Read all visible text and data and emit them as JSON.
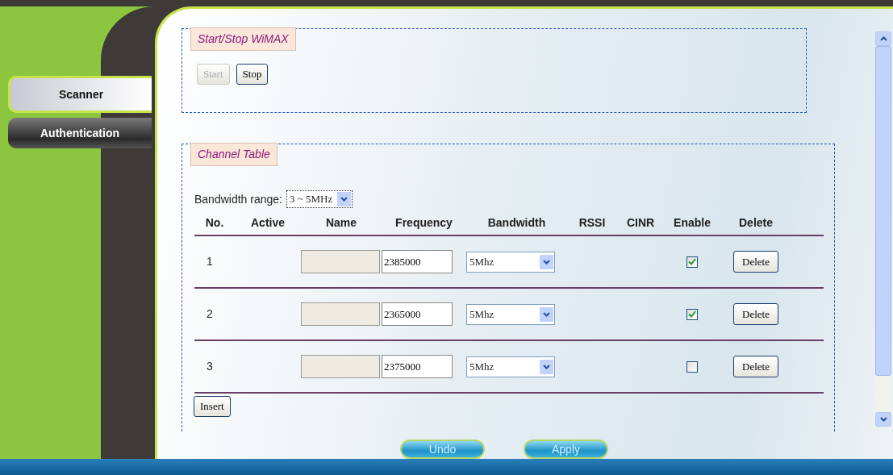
{
  "sidebar": {
    "tabs": [
      {
        "label": "Scanner",
        "selected": true
      },
      {
        "label": "Authentication",
        "selected": false
      }
    ]
  },
  "start_stop": {
    "legend": "Start/Stop WiMAX",
    "buttons": [
      {
        "label": "Start",
        "disabled": true
      },
      {
        "label": "Stop",
        "disabled": false
      }
    ]
  },
  "channel_table": {
    "legend": "Channel Table",
    "bandwidth_range": {
      "label": "Bandwidth range:",
      "value": "3 ~ 5MHz"
    },
    "columns": [
      "No.",
      "Active",
      "Name",
      "Frequency",
      "Bandwidth",
      "RSSI",
      "CINR",
      "Enable",
      "Delete"
    ],
    "rows": [
      {
        "no": "1",
        "frequency": "2385000",
        "bandwidth": "5Mhz",
        "enabled": true,
        "delete": "Delete"
      },
      {
        "no": "2",
        "frequency": "2365000",
        "bandwidth": "5Mhz",
        "enabled": true,
        "delete": "Delete"
      },
      {
        "no": "3",
        "frequency": "2375000",
        "bandwidth": "5Mhz",
        "enabled": false,
        "delete": "Delete"
      }
    ],
    "insert": "Insert"
  },
  "footer_buttons": [
    "Undo",
    "Apply"
  ]
}
